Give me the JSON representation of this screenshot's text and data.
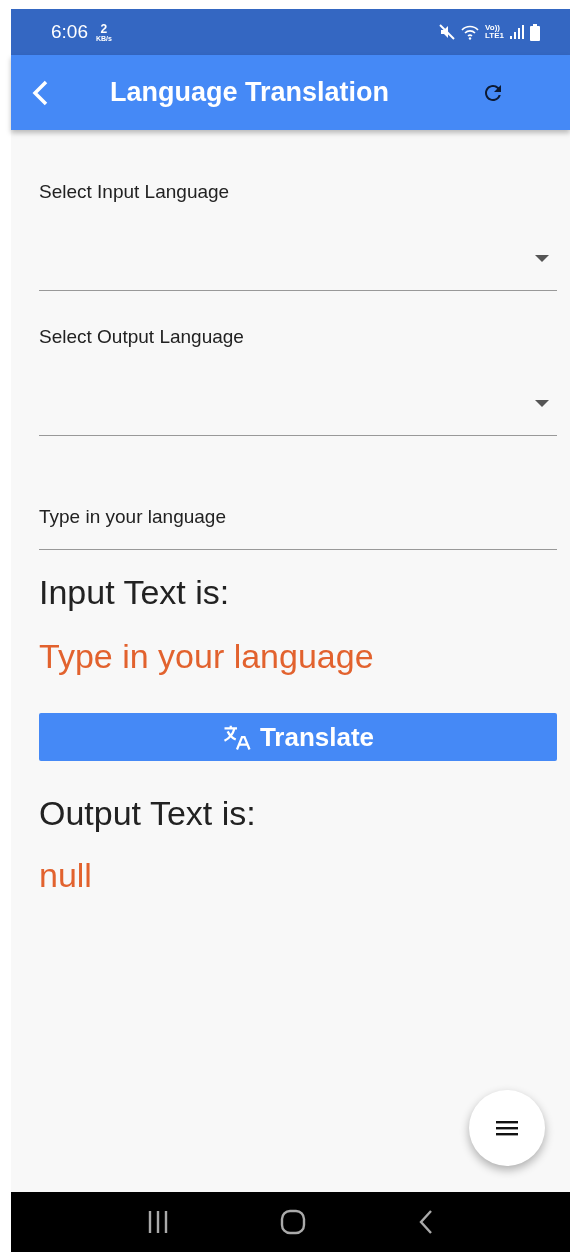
{
  "status_bar": {
    "time": "6:06",
    "speed_value": "2",
    "speed_unit": "KB/s",
    "network_top": "Vo))",
    "network_bottom": "LTE1"
  },
  "app_bar": {
    "title": "Language Translation"
  },
  "dropdowns": [
    {
      "label": "Select Input Language"
    },
    {
      "label": "Select Output Language"
    }
  ],
  "text_field": {
    "placeholder": "Type in your language"
  },
  "input_heading": "Input Text is:",
  "input_text": "Type in your language",
  "translate_button": {
    "label": "Translate"
  },
  "output_heading": "Output Text is:",
  "output_text": "null"
}
